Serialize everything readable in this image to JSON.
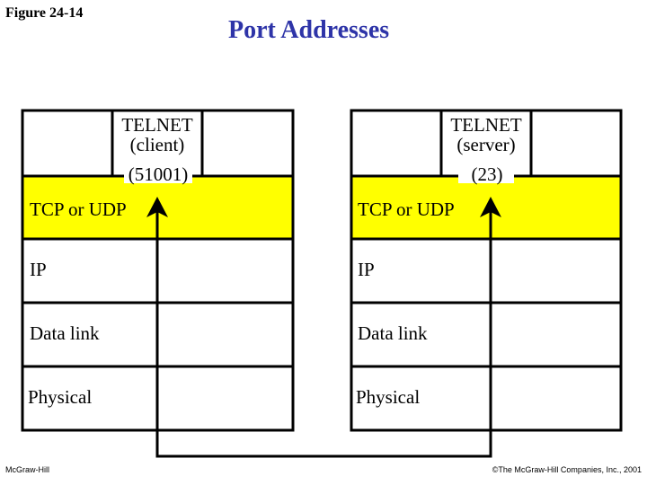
{
  "figure_label": "Figure 24-14",
  "title": "Port Addresses",
  "footer": {
    "left": "McGraw-Hill",
    "right": "©The McGraw-Hill Companies, Inc., 2001"
  },
  "colors": {
    "title": "#2e34a8",
    "transport_layer": "#ffff00",
    "lines": "#000000"
  },
  "stacks": [
    {
      "app_name": "TELNET",
      "app_role": "(client)",
      "port": "(51001)",
      "layers": [
        "TCP or UDP",
        "IP",
        "Data link",
        "Physical"
      ]
    },
    {
      "app_name": "TELNET",
      "app_role": "(server)",
      "port": "(23)",
      "layers": [
        "TCP or UDP",
        "IP",
        "Data link",
        "Physical"
      ]
    }
  ]
}
